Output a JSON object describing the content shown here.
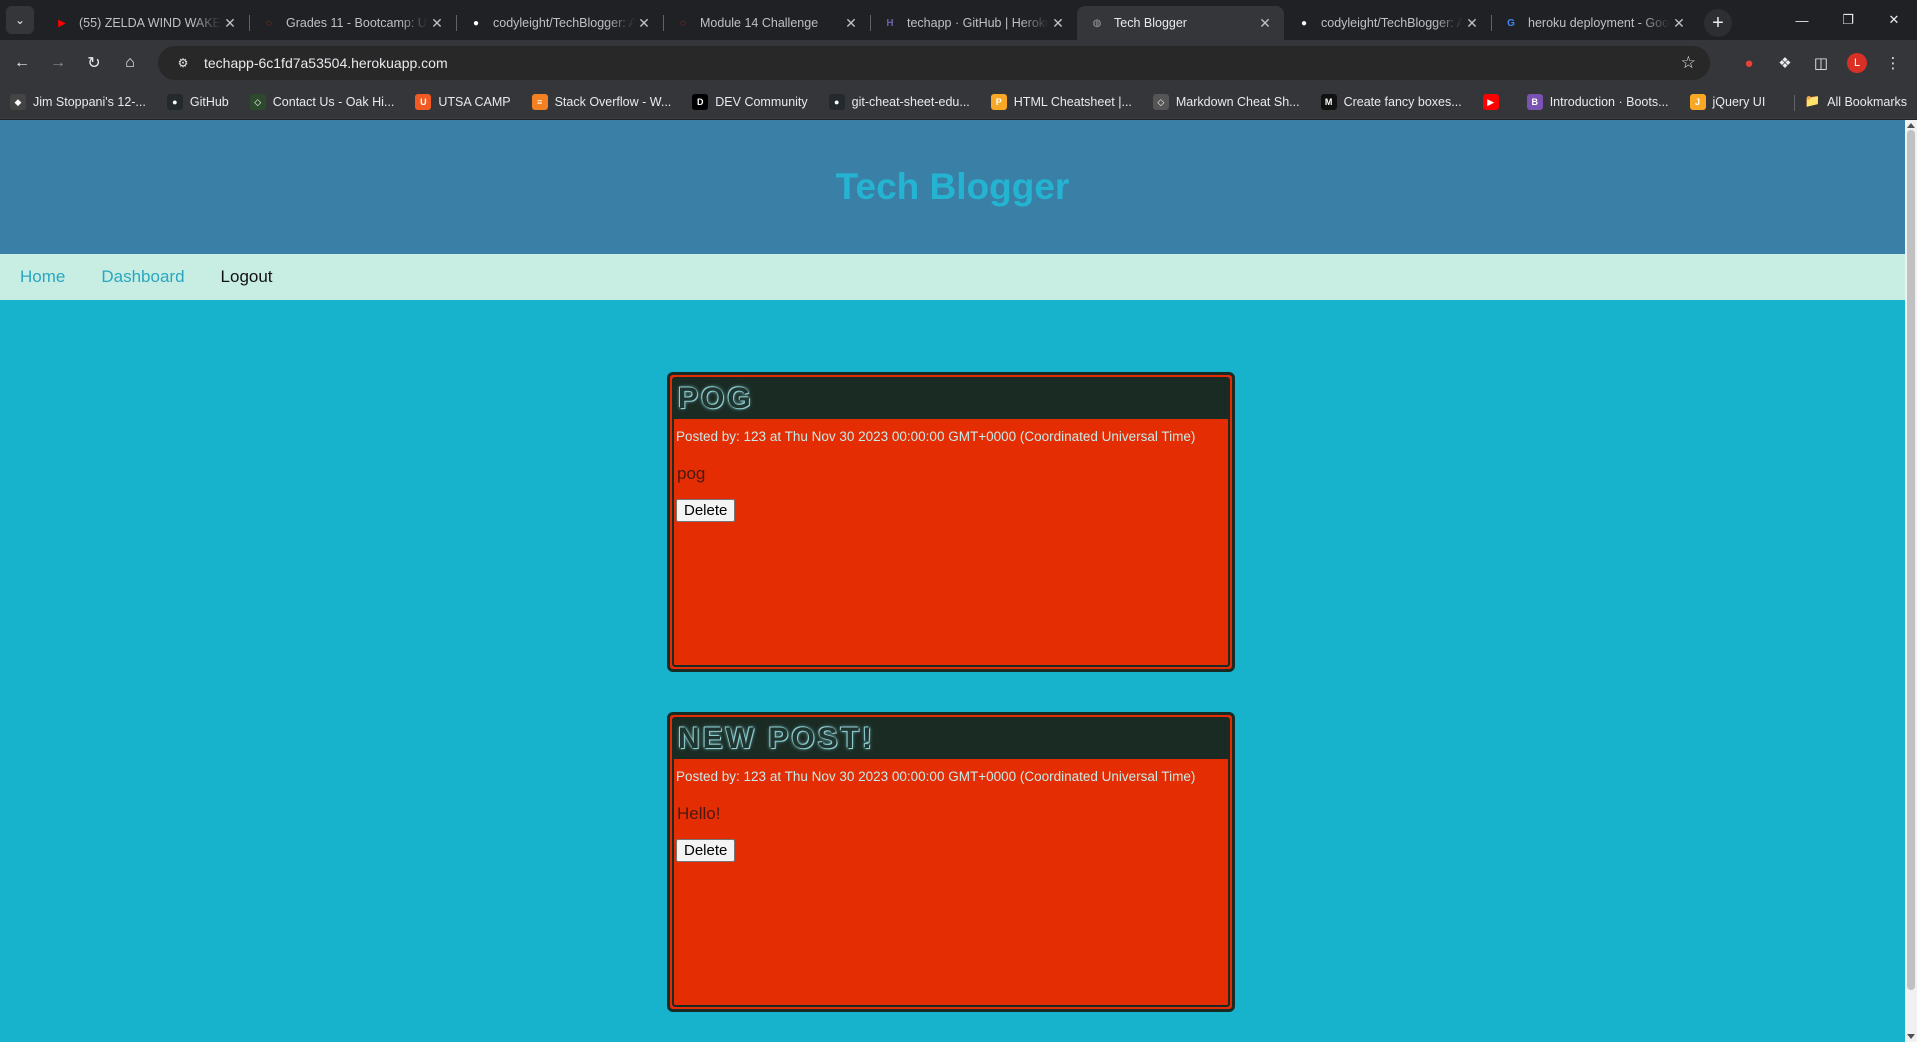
{
  "browser": {
    "tabs": [
      {
        "title": "(55) ZELDA WIND WAKER",
        "icon": "youtube-icon",
        "color": "#ff0000",
        "active": false
      },
      {
        "title": "Grades 11 - Bootcamp: UT",
        "icon": "canvas-icon",
        "color": "#e5311d",
        "active": false
      },
      {
        "title": "codyleight/TechBlogger: A",
        "icon": "github-icon",
        "color": "#ffffff",
        "active": false
      },
      {
        "title": "Module 14 Challenge",
        "icon": "canvas-icon",
        "color": "#e5311d",
        "active": false
      },
      {
        "title": "techapp · GitHub | Heroku",
        "icon": "heroku-icon",
        "color": "#6762a6",
        "active": false
      },
      {
        "title": "Tech Blogger",
        "icon": "globe-icon",
        "color": "#9aa0a6",
        "active": true
      },
      {
        "title": "codyleight/TechBlogger: A",
        "icon": "github-icon",
        "color": "#ffffff",
        "active": false
      },
      {
        "title": "heroku deployment - Goo",
        "icon": "google-icon",
        "color": "#4285f4",
        "active": false
      }
    ],
    "url": "techapp-6c1fd7a53504.herokuapp.com",
    "profile_initial": "L",
    "bookmarks": [
      {
        "label": "Jim Stoppani's 12-...",
        "icon": "bookmark-site-icon",
        "color": "#444"
      },
      {
        "label": "GitHub",
        "icon": "github-icon",
        "color": "#24292e"
      },
      {
        "label": "Contact Us - Oak Hi...",
        "icon": "site-icon",
        "color": "#2d4a2d"
      },
      {
        "label": "UTSA CAMP",
        "icon": "utsa-icon",
        "color": "#f15a22"
      },
      {
        "label": "Stack Overflow - W...",
        "icon": "stackoverflow-icon",
        "color": "#f48024"
      },
      {
        "label": "DEV Community",
        "icon": "dev-icon",
        "color": "#000000"
      },
      {
        "label": "git-cheat-sheet-edu...",
        "icon": "github-icon",
        "color": "#24292e"
      },
      {
        "label": "HTML Cheatsheet |...",
        "icon": "ps-icon",
        "color": "#f9a825"
      },
      {
        "label": "Markdown Cheat Sh...",
        "icon": "site-icon",
        "color": "#555555"
      },
      {
        "label": "Create fancy boxes...",
        "icon": "m-icon",
        "color": "#111111"
      },
      {
        "label": "",
        "icon": "youtube-icon",
        "color": "#ff0000"
      },
      {
        "label": "Introduction · Boots...",
        "icon": "bootstrap-icon",
        "color": "#7952b3"
      },
      {
        "label": "jQuery UI",
        "icon": "jquery-icon",
        "color": "#f9a825"
      }
    ],
    "all_bookmarks": "All Bookmarks"
  },
  "site": {
    "title": "Tech Blogger",
    "nav": {
      "home": "Home",
      "dashboard": "Dashboard",
      "logout": "Logout"
    },
    "colors": {
      "page_bg": "#17b2cc",
      "header_bg": "#3a80a6",
      "nav_bg": "#c8eee3",
      "post_bg": "#e52d03"
    }
  },
  "posts": [
    {
      "title": "POG",
      "meta": "Posted by: 123 at Thu Nov 30 2023 00:00:00 GMT+0000 (Coordinated Universal Time)",
      "body": "pog",
      "delete_label": "Delete"
    },
    {
      "title": "NEW POST!",
      "meta": "Posted by: 123 at Thu Nov 30 2023 00:00:00 GMT+0000 (Coordinated Universal Time)",
      "body": "Hello!",
      "delete_label": "Delete"
    }
  ]
}
